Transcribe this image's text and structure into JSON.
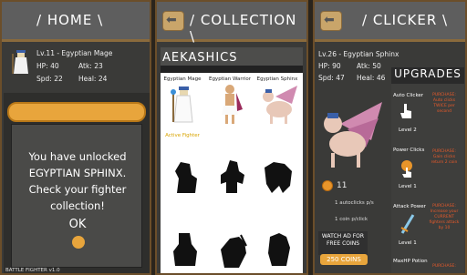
{
  "home": {
    "title": "/ HOME \\",
    "fighter": {
      "level_name": "Lv.11 - Egyptian Mage",
      "hp": "HP: 40",
      "atk": "Atk: 23",
      "spd": "Spd: 22",
      "heal": "Heal: 24"
    },
    "popup": {
      "message": "You have unlocked EGYPTIAN SPHINX. Check your fighter collection!",
      "ok_label": "OK"
    },
    "version": "BATTLE FIGHTER v1.0"
  },
  "collection": {
    "title": "/ COLLECTION \\",
    "section_title": "AEKASHICS",
    "fighters": [
      {
        "name": "Egyptian Mage",
        "tag": "Active Fighter"
      },
      {
        "name": "Egyptian Warrior",
        "tag": ""
      },
      {
        "name": "Egyptian Sphinx",
        "tag": ""
      }
    ]
  },
  "clicker": {
    "title": "/ CLICKER \\",
    "fighter": {
      "level_name": "Lv.26 - Egyptian Sphinx",
      "hp": "HP: 90",
      "atk": "Atk: 50",
      "spd": "Spd: 47",
      "heal": "Heal: 46"
    },
    "coin_count": "11",
    "autoclicks": "1 autoclicks p/s",
    "coin_per_click": "1 coin p/click",
    "watch_ad": "WATCH AD FOR FREE COINS",
    "coins_button": "250 COINS",
    "upgrades_title": "UPGRADES",
    "upgrades": [
      {
        "name": "Auto Clicker",
        "level": "Level 2",
        "desc": "PURCHASE: Auto clicks TWICE per second"
      },
      {
        "name": "Power Clicks",
        "level": "Level 1",
        "desc": "PURCHASE: Gain clicks return 2 coin"
      },
      {
        "name": "Attack Power",
        "level": "Level 1",
        "desc": "PURCHASE: Increase your CURRENT fighters attack by 10"
      },
      {
        "name": "MaxHP Potion",
        "level": "",
        "desc": "PURCHASE:"
      }
    ],
    "colors": {
      "accent": "#e8a53c",
      "frame": "#6b4e2a",
      "desc_red": "#e85a2a"
    }
  }
}
